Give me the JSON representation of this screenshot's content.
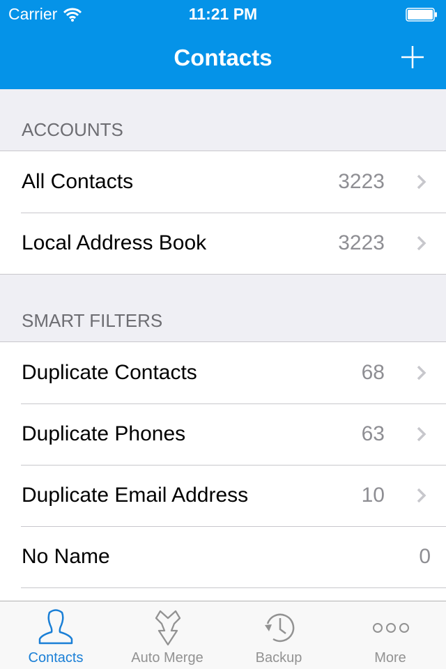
{
  "status_bar": {
    "carrier": "Carrier",
    "time": "11:21 PM"
  },
  "nav": {
    "title": "Contacts",
    "add_icon": "plus-icon"
  },
  "sections": [
    {
      "header": "ACCOUNTS",
      "rows": [
        {
          "label": "All Contacts",
          "count": "3223",
          "chevron": true
        },
        {
          "label": "Local Address Book",
          "count": "3223",
          "chevron": true
        }
      ]
    },
    {
      "header": "SMART FILTERS",
      "rows": [
        {
          "label": "Duplicate Contacts",
          "count": "68",
          "chevron": true
        },
        {
          "label": "Duplicate Phones",
          "count": "63",
          "chevron": true
        },
        {
          "label": "Duplicate Email Address",
          "count": "10",
          "chevron": true
        },
        {
          "label": "No Name",
          "count": "0",
          "chevron": false
        }
      ]
    }
  ],
  "tabbar": {
    "active": "Contacts",
    "tabs": [
      {
        "label": "Contacts",
        "icon": "person-icon"
      },
      {
        "label": "Auto Merge",
        "icon": "merge-arrow-icon"
      },
      {
        "label": "Backup",
        "icon": "clock-history-icon"
      },
      {
        "label": "More",
        "icon": "more-dots-icon"
      }
    ]
  },
  "colors": {
    "accent": "#0593e8",
    "tab_active": "#1a7fd6",
    "tab_inactive": "#929292"
  }
}
